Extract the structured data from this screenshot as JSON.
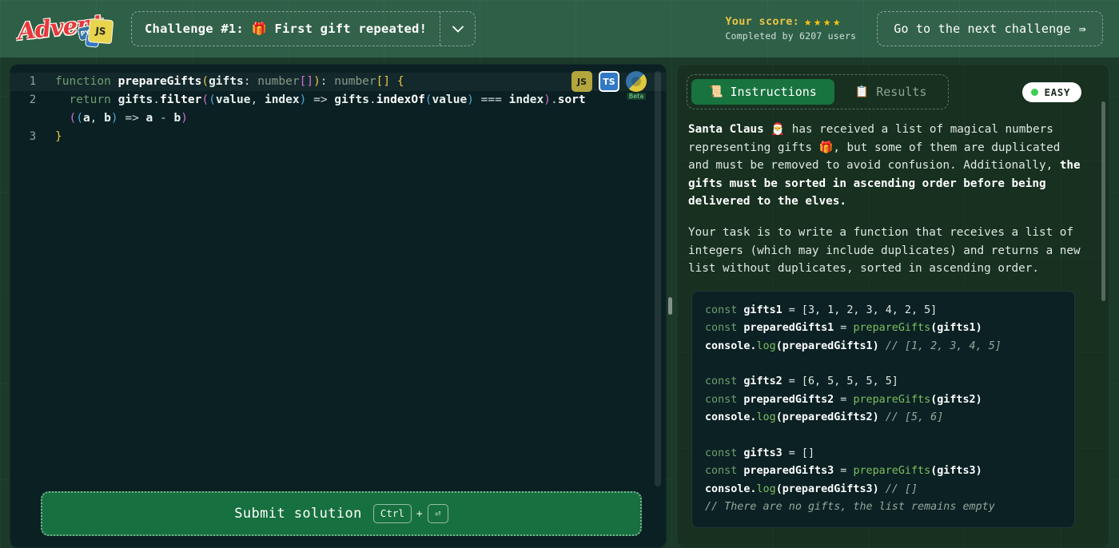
{
  "header": {
    "logo_text": "Advent",
    "logo_badges": [
      "PY",
      "TS",
      "JS"
    ],
    "challenge_label": "Challenge #1: 🎁 First gift repeated!",
    "caret_icon": "chevron-down-icon",
    "score_label": "Your score:",
    "stars": [
      "★",
      "★",
      "★",
      "★"
    ],
    "completed_text": "Completed by 6207 users",
    "next_label": "Go to the next challenge",
    "next_arrow": "⇛"
  },
  "editor": {
    "lang_icons": [
      {
        "name": "js",
        "label": "JS"
      },
      {
        "name": "ts",
        "label": "TS"
      },
      {
        "name": "python",
        "label": "",
        "tag": "Beta"
      }
    ],
    "lines": [
      {
        "num": "1",
        "active": true
      },
      {
        "num": "2",
        "active": false
      },
      {
        "num": "",
        "active": false
      },
      {
        "num": "3",
        "active": false
      }
    ],
    "code_line1": "function prepareGifts(gifts: number[]): number[] {",
    "code_line2": "  return gifts.filter((value, index) => gifts.indexOf(value) === index).sort",
    "code_line2b": "  ((a, b) => a - b)",
    "code_line3": "}",
    "submit_label": "Submit solution",
    "kbd_ctrl": "Ctrl",
    "kbd_plus": "+",
    "kbd_enter": "⏎"
  },
  "instructions": {
    "tabs": [
      {
        "label": "Instructions",
        "icon": "scroll-icon",
        "active": true
      },
      {
        "label": "Results",
        "icon": "clipboard-icon",
        "active": false
      }
    ],
    "difficulty": "EASY",
    "difficulty_color": "#3ecf53",
    "para1_bold_start": "Santa Claus",
    "para1_emoji": " 🎅 ",
    "para1_mid": "has received a list of magical numbers representing gifts 🎁, but some of them are duplicated and must be removed to avoid confusion. Additionally, ",
    "para1_bold_end": "the gifts must be sorted in ascending order before being delivered to the elves.",
    "para2": "Your task is to write a function that receives a list of integers (which may include duplicates) and returns a new list without duplicates, sorted in ascending order.",
    "example": {
      "b1_l1_kw": "const",
      "b1_l1_var": " gifts1",
      "b1_l1_rest": " = [3, 1, 2, 3, 4, 2, 5]",
      "b1_l2_kw": "const",
      "b1_l2_var": " preparedGifts1",
      "b1_l2_eq": " = ",
      "b1_l2_fn": "prepareGifts",
      "b1_l2_arg": "(gifts1)",
      "b1_l3_call": "console.",
      "b1_l3_log": "log",
      "b1_l3_arg": "(preparedGifts1) ",
      "b1_l3_comment": "// [1, 2, 3, 4, 5]",
      "b2_l1_kw": "const",
      "b2_l1_var": " gifts2",
      "b2_l1_rest": " = [6, 5, 5, 5, 5]",
      "b2_l2_kw": "const",
      "b2_l2_var": " preparedGifts2",
      "b2_l2_eq": " = ",
      "b2_l2_fn": "prepareGifts",
      "b2_l2_arg": "(gifts2)",
      "b2_l3_call": "console.",
      "b2_l3_log": "log",
      "b2_l3_arg": "(preparedGifts2) ",
      "b2_l3_comment": "// [5, 6]",
      "b3_l1_kw": "const",
      "b3_l1_var": " gifts3",
      "b3_l1_rest": " = []",
      "b3_l2_kw": "const",
      "b3_l2_var": " preparedGifts3",
      "b3_l2_eq": " = ",
      "b3_l2_fn": "prepareGifts",
      "b3_l2_arg": "(gifts3)",
      "b3_l3_call": "console.",
      "b3_l3_log": "log",
      "b3_l3_arg": "(preparedGifts3) ",
      "b3_l3_comment": "// []",
      "b3_l4_comment": "// There are no gifts, the list remains empty"
    }
  }
}
